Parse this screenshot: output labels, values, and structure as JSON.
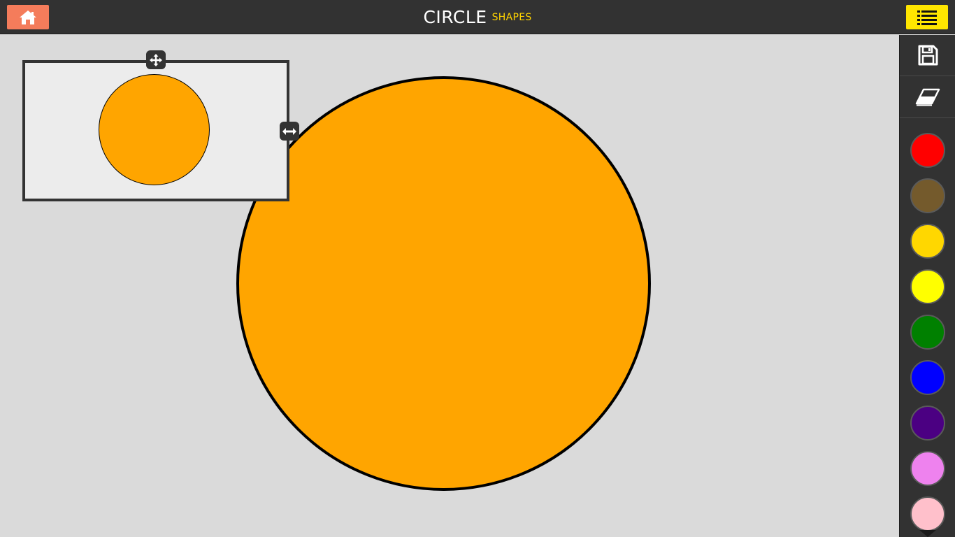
{
  "header": {
    "title": "CIRCLE",
    "subtitle": "SHAPES",
    "home_icon": "home-icon",
    "menu_icon": "list-icon"
  },
  "colors": {
    "topbar_bg": "#323232",
    "home_button": "#f47c5b",
    "menu_button": "#ffe600",
    "subtitle": "#ffd400",
    "canvas_bg": "#dadada",
    "shape_fill": "#ffa500",
    "shape_stroke": "#000000"
  },
  "toolbar": {
    "tools": [
      {
        "name": "save",
        "icon": "floppy-disk-icon"
      },
      {
        "name": "eraser",
        "icon": "eraser-icon"
      }
    ],
    "swatches": [
      {
        "name": "red",
        "color": "#ff0000"
      },
      {
        "name": "brown",
        "color": "#745a2c"
      },
      {
        "name": "gold",
        "color": "#ffd700"
      },
      {
        "name": "yellow",
        "color": "#ffff00"
      },
      {
        "name": "green",
        "color": "#008000"
      },
      {
        "name": "blue",
        "color": "#0000ff"
      },
      {
        "name": "indigo",
        "color": "#4b0082"
      },
      {
        "name": "violet",
        "color": "#ee82ee"
      },
      {
        "name": "pink",
        "color": "#ffc0cb"
      }
    ]
  },
  "canvas": {
    "shape": "circle",
    "fill": "#ffa500"
  },
  "preview": {
    "shape": "circle",
    "fill": "#ffa500",
    "move_icon": "move-arrows-icon",
    "resize_icon": "resize-horizontal-icon"
  }
}
